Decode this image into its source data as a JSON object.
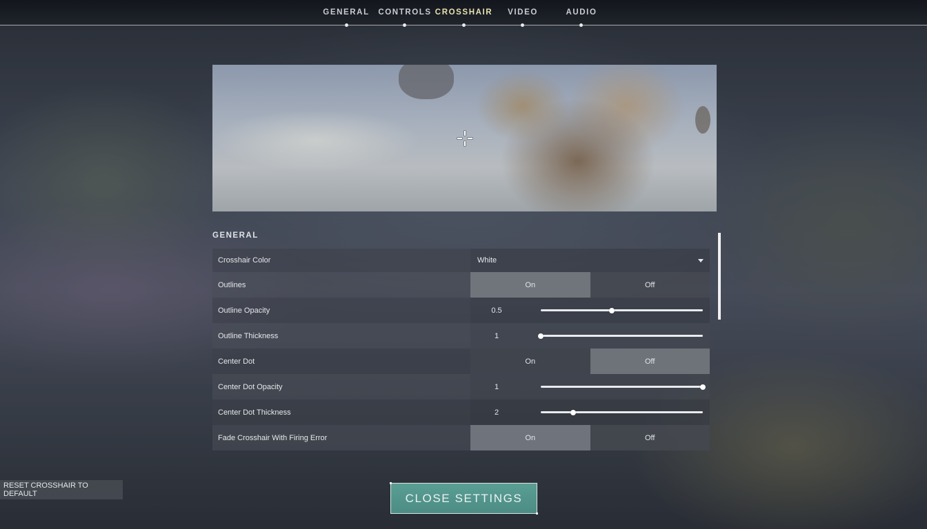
{
  "nav": {
    "tabs": [
      {
        "label": "GENERAL",
        "active": false
      },
      {
        "label": "CONTROLS",
        "active": false
      },
      {
        "label": "CROSSHAIR",
        "active": true
      },
      {
        "label": "VIDEO",
        "active": false
      },
      {
        "label": "AUDIO",
        "active": false
      }
    ]
  },
  "section": {
    "title": "GENERAL"
  },
  "settings": {
    "crosshair_color": {
      "label": "Crosshair Color",
      "value": "White"
    },
    "outlines": {
      "label": "Outlines",
      "on": "On",
      "off": "Off",
      "selected": "On"
    },
    "outline_opacity": {
      "label": "Outline Opacity",
      "value": "0.5",
      "level": 0.44
    },
    "outline_thickness": {
      "label": "Outline Thickness",
      "value": "1",
      "level": 0.0
    },
    "center_dot": {
      "label": "Center Dot",
      "on": "On",
      "off": "Off",
      "selected": "Off"
    },
    "center_dot_opacity": {
      "label": "Center Dot Opacity",
      "value": "1",
      "level": 1.0
    },
    "center_dot_thickness": {
      "label": "Center Dot Thickness",
      "value": "2",
      "level": 0.2
    },
    "fade_crosshair": {
      "label": "Fade Crosshair With Firing Error",
      "on": "On",
      "off": "Off",
      "selected": "On"
    }
  },
  "buttons": {
    "reset": "RESET CROSSHAIR TO DEFAULT",
    "close": "CLOSE SETTINGS"
  },
  "colors": {
    "accent_teal": "#4f9188",
    "active_tab": "#e6e2b0"
  }
}
